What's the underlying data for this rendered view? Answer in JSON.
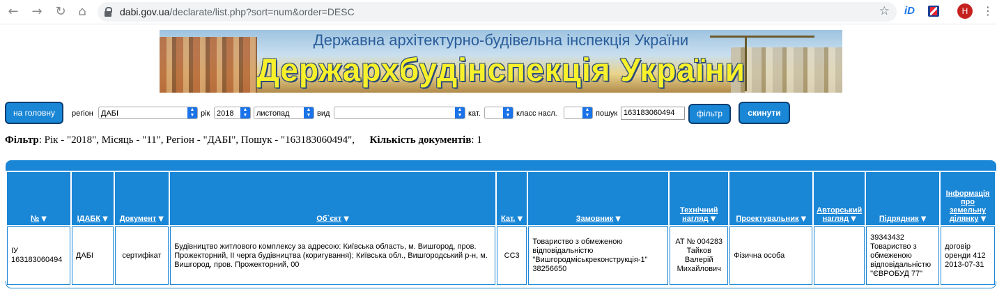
{
  "browser": {
    "url_host": "dabi.gov.ua",
    "url_path": "/declarate/list.php?sort=num&order=DESC",
    "profile_initial": "H",
    "ext1_label": "iD"
  },
  "banner": {
    "subtitle": "Державна архітектурно-будівельна інспекція України",
    "title": "Держархбудінспекція України"
  },
  "filters": {
    "home_button": "на головну",
    "region_label": "регіон",
    "region_value": "ДАБІ",
    "year_label": "рік",
    "year_value": "2018",
    "month_value": "листопад",
    "type_label": "вид",
    "type_value": "",
    "cat_label": "кат.",
    "cat_value": "",
    "class_label": "класс насл.",
    "class_value": "",
    "search_label": "пошук",
    "search_value": "163183060494",
    "filter_button": "фільтр",
    "reset_button": "скинути"
  },
  "summary": {
    "filter_label": "Фільтр",
    "filter_text": ": Рік - \"2018\", Місяць - \"11\", Регіон - \"ДАБІ\", Пошук - \"163183060494\",",
    "count_label": "Кількість документів",
    "count_value": ": 1"
  },
  "table": {
    "sort_arrow": "▼",
    "headers": [
      "№",
      "ІДАБК",
      "Документ",
      "Об`єкт",
      "Кат.",
      "Замовник",
      "Технічний нагляд",
      "Проектувальник",
      "Авторський нагляд",
      "Підрядник",
      "Інформація про земельну ділянку"
    ],
    "rows": [
      {
        "num": "ІУ 163183060494",
        "idabk": "ДАБІ",
        "doc": "сертифікат",
        "object": "Будівництво житлового комплексу за адресою: Київська область, м. Вишгород, пров. Прожекторний, ІІ черга будівництва (коригування); Київська обл., Вишгородський р-н, м. Вишгород, пров. Прожекторний, 00",
        "cat": "СС3",
        "customer": "Товариство з обмеженою відповідальністю \"Вишгородміськреконструкція-1\" 38256650",
        "tech": "АТ № 004283 Тайков Валерій Михайлович",
        "designer": "Фізична особа",
        "author": "",
        "contractor": "39343432 Товариство з обмеженою відповідальністю \"ЄВРОБУД 77\"",
        "land": "договір оренди 412 2013-07-31"
      }
    ]
  }
}
